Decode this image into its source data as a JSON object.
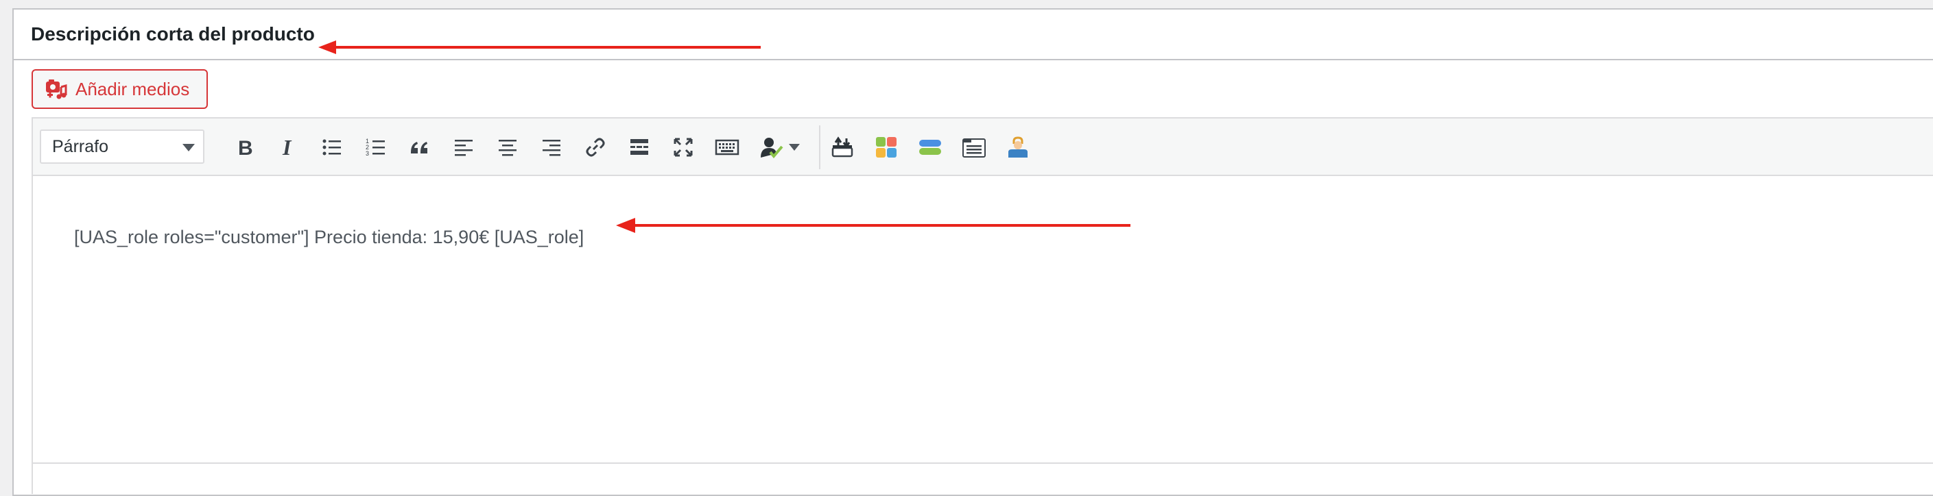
{
  "panel": {
    "title": "Descripción corta del producto"
  },
  "media_button": {
    "label": "Añadir medios",
    "icon": "add-media-icon"
  },
  "toolbar": {
    "format_select": {
      "value": "Párrafo"
    },
    "buttons": [
      "bold-icon",
      "italic-icon",
      "bulleted-list-icon",
      "numbered-list-icon",
      "blockquote-icon",
      "align-left-icon",
      "align-center-icon",
      "align-right-icon",
      "link-icon",
      "read-more-icon",
      "fullscreen-icon",
      "keyboard-icon",
      "user-role-icon",
      "dropdown-caret-icon",
      "shortcode-insert-icon",
      "color-blocks-icon",
      "buttons-icon",
      "tabs-icon",
      "user-lock-icon"
    ]
  },
  "content": {
    "text": "[UAS_role roles=\"customer\"] Precio tienda: 15,90€ [UAS_role]"
  },
  "colors": {
    "accent_red": "#d63638",
    "annotation_arrow": "#e8231b"
  }
}
